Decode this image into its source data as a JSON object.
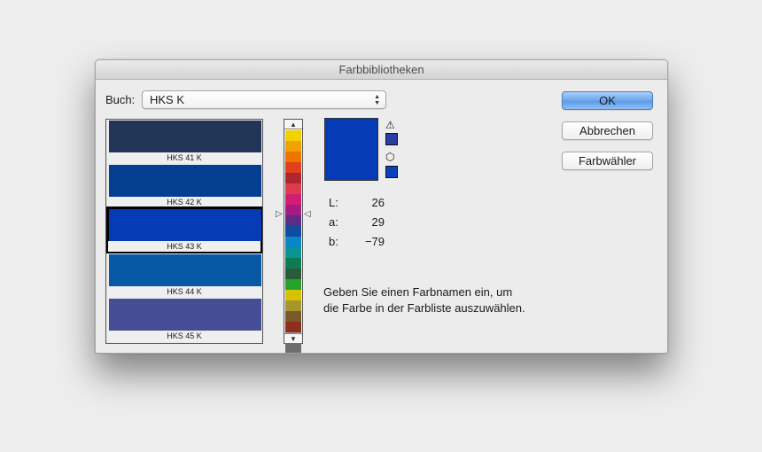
{
  "window": {
    "title": "Farbbibliotheken"
  },
  "book": {
    "label": "Buch:",
    "value": "HKS K"
  },
  "swatches": [
    {
      "name": "HKS 41 K",
      "color": "#213657"
    },
    {
      "name": "HKS 42 K",
      "color": "#043e91"
    },
    {
      "name": "HKS 43 K",
      "color": "#053cb5",
      "selected": true
    },
    {
      "name": "HKS 44 K",
      "color": "#0759a6"
    },
    {
      "name": "HKS 45 K",
      "color": "#454e95"
    }
  ],
  "spectrum_colors": [
    "#f4d000",
    "#f3a100",
    "#ee7400",
    "#e0401e",
    "#b0262f",
    "#df3a4d",
    "#d21c75",
    "#a51b83",
    "#5e2b85",
    "#0f4da1",
    "#0a86c7",
    "#0a9590",
    "#0e7b53",
    "#2b5a3a",
    "#27a22a",
    "#d6c200",
    "#a6952a",
    "#7a5a2c",
    "#8f2d1f",
    "#9a9a9a",
    "#6e6e6e"
  ],
  "preview": {
    "color": "#053cb5",
    "gamut_warning_icon": "warning-icon",
    "gamut_swatch_color": "#2a3da0",
    "web_icon": "cube-icon",
    "web_swatch_color": "#0a3fbf"
  },
  "lab": {
    "L": {
      "label": "L:",
      "value": "26"
    },
    "a": {
      "label": "a:",
      "value": "29"
    },
    "b": {
      "label": "b:",
      "value": "−79"
    }
  },
  "hint": {
    "line1": "Geben Sie einen Farbnamen ein, um",
    "line2": "die Farbe in der Farbliste auszuwählen."
  },
  "buttons": {
    "ok": "OK",
    "cancel": "Abbrechen",
    "picker": "Farbwähler"
  }
}
